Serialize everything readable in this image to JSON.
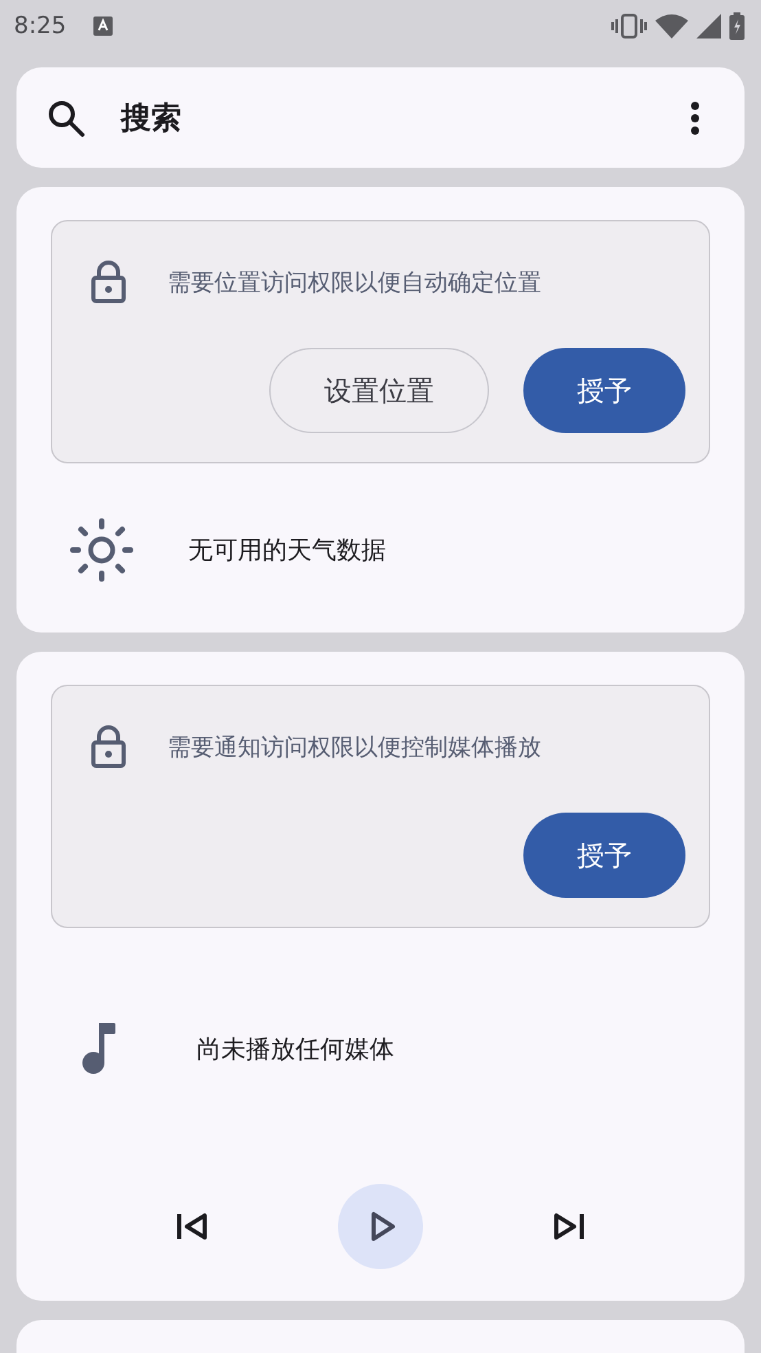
{
  "status_bar": {
    "time": "8:25"
  },
  "search": {
    "label": "搜索"
  },
  "widgets": [
    {
      "kind": "weather",
      "permission": {
        "message": "需要位置访问权限以便自动确定位置",
        "buttons": [
          {
            "label": "设置位置",
            "kind": "outlined"
          },
          {
            "label": "授予",
            "kind": "filled"
          }
        ]
      },
      "message": "无可用的天气数据"
    },
    {
      "kind": "media",
      "permission": {
        "message": "需要通知访问权限以便控制媒体播放",
        "buttons": [
          {
            "label": "授予",
            "kind": "filled"
          }
        ]
      },
      "message": "尚未播放任何媒体"
    }
  ]
}
